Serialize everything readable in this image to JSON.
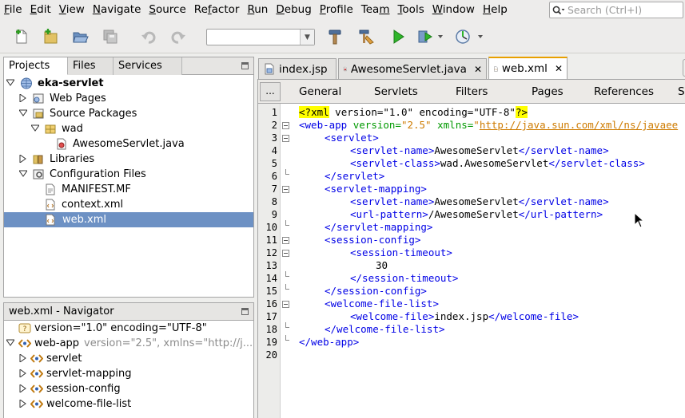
{
  "menu": [
    {
      "key": "F",
      "rest": "ile"
    },
    {
      "key": "E",
      "rest": "dit"
    },
    {
      "key": "V",
      "rest": "iew"
    },
    {
      "key": "N",
      "rest": "avigate"
    },
    {
      "key": "S",
      "rest": "ource"
    },
    {
      "key": "R",
      "rest": "efactor"
    },
    {
      "key": "R",
      "rest": "un"
    },
    {
      "key": "D",
      "rest": "ebug"
    },
    {
      "key": "P",
      "rest": "rofile"
    },
    {
      "key": "T",
      "rest": "eam"
    },
    {
      "key": "T",
      "rest": "ools"
    },
    {
      "key": "W",
      "rest": "indow"
    },
    {
      "key": "H",
      "rest": "elp"
    }
  ],
  "menu_split": [
    [
      "",
      "F",
      "ile"
    ],
    [
      "",
      "E",
      "dit"
    ],
    [
      "",
      "V",
      "iew"
    ],
    [
      "",
      "N",
      "avigate"
    ],
    [
      "",
      "S",
      "ource"
    ],
    [
      "Re",
      "f",
      "actor"
    ],
    [
      "",
      "R",
      "un"
    ],
    [
      "",
      "D",
      "ebug"
    ],
    [
      "",
      "P",
      "rofile"
    ],
    [
      "Tea",
      "m",
      ""
    ],
    [
      "",
      "T",
      "ools"
    ],
    [
      "",
      "W",
      "indow"
    ],
    [
      "",
      "H",
      "elp"
    ]
  ],
  "search": {
    "placeholder": "Search (Ctrl+I)"
  },
  "project_tabs": [
    "Projects",
    "Files",
    "Services"
  ],
  "project_tree": {
    "root": "eka-servlet",
    "web_pages": "Web Pages",
    "source_packages": "Source Packages",
    "package": "wad",
    "servlet_file": "AwesomeServlet.java",
    "libraries": "Libraries",
    "config_files": "Configuration Files",
    "manifest": "MANIFEST.MF",
    "context": "context.xml",
    "webxml": "web.xml"
  },
  "navigator": {
    "title": "web.xml - Navigator",
    "decl": "version=\"1.0\" encoding=\"UTF-8\"",
    "root_tag": "web-app",
    "root_attrs": "version=\"2.5\", xmlns=\"http://j...",
    "children": [
      "servlet",
      "servlet-mapping",
      "session-config",
      "welcome-file-list"
    ]
  },
  "editor_tabs": [
    "index.jsp",
    "AwesomeServlet.java",
    "web.xml"
  ],
  "multiview": {
    "dots": "...",
    "items": [
      "General",
      "Servlets",
      "Filters",
      "Pages",
      "References",
      "S"
    ]
  },
  "line_numbers": [
    "1",
    "2",
    "3",
    "4",
    "5",
    "6",
    "7",
    "8",
    "9",
    "10",
    "11",
    "12",
    "13",
    "14",
    "15",
    "16",
    "17",
    "18",
    "19",
    "20"
  ],
  "code": {
    "l1_pi_open": "<?",
    "l1_name": "xml",
    "l1_rest": " version=\"1.0\" encoding=\"UTF-8\"",
    "l1_pi_close": "?>",
    "l2_tag": "<web-app",
    "l2_attr1": " version=",
    "l2_val1": "\"2.5\"",
    "l2_attr2": " xmlns=",
    "l2_q": "\"",
    "l2_url": "http://java.sun.com/xml/ns/javaee",
    "servlet_open": "<servlet>",
    "servlet_close": "</servlet>",
    "sname_open": "<servlet-name>",
    "sname_close": "</servlet-name>",
    "sname_value": "AwesomeServlet",
    "sclass_open": "<servlet-class>",
    "sclass_close": "</servlet-class>",
    "sclass_value": "wad.AwesomeServlet",
    "mapping_open": "<servlet-mapping>",
    "mapping_close": "</servlet-mapping>",
    "url_open": "<url-pattern>",
    "url_close": "</url-pattern>",
    "url_value": "/AwesomeServlet",
    "session_open": "<session-config>",
    "session_close": "</session-config>",
    "timeout_open": "<session-timeout>",
    "timeout_close": "</session-timeout>",
    "timeout_value": "30",
    "welcome_list_open": "<welcome-file-list>",
    "welcome_list_close": "</welcome-file-list>",
    "welcome_open": "<welcome-file>",
    "welcome_close": "</welcome-file>",
    "welcome_value": "index.jsp",
    "webapp_close": "</web-app>"
  }
}
